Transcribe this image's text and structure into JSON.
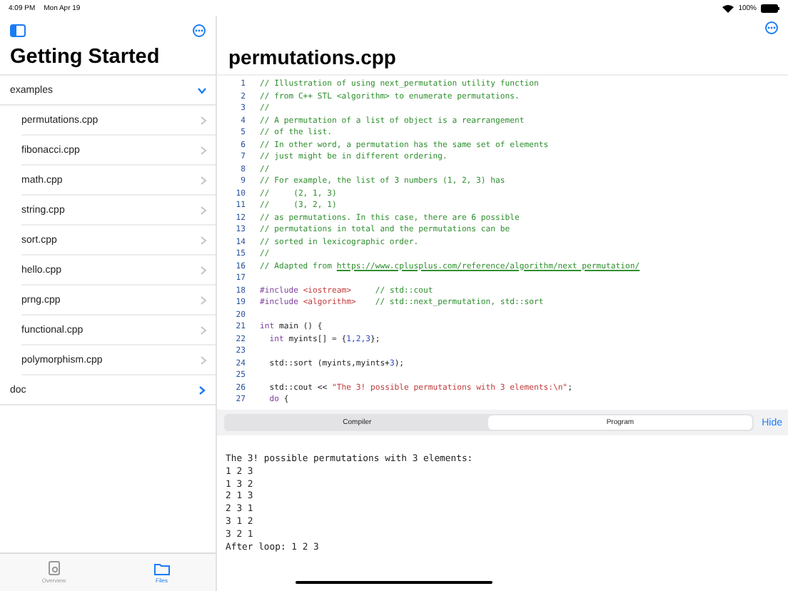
{
  "status_bar": {
    "time": "4:09 PM",
    "date": "Mon Apr 19",
    "battery": "100%"
  },
  "sidebar": {
    "title": "Getting Started",
    "tree": [
      {
        "label": "examples",
        "expanded": true,
        "children": [
          {
            "label": "permutations.cpp"
          },
          {
            "label": "fibonacci.cpp"
          },
          {
            "label": "math.cpp"
          },
          {
            "label": "string.cpp"
          },
          {
            "label": "sort.cpp"
          },
          {
            "label": "hello.cpp"
          },
          {
            "label": "prng.cpp"
          },
          {
            "label": "functional.cpp"
          },
          {
            "label": "polymorphism.cpp"
          }
        ]
      },
      {
        "label": "doc",
        "expanded": false
      }
    ]
  },
  "tab_bar": [
    {
      "label": "Overview",
      "selected": false
    },
    {
      "label": "Files",
      "selected": true
    }
  ],
  "editor": {
    "title": "permutations.cpp",
    "lines": [
      {
        "number": "1",
        "tokens": [
          {
            "kind": "comment",
            "text": "// Illustration of using next_permutation utility function"
          }
        ]
      },
      {
        "number": "2",
        "tokens": [
          {
            "kind": "comment",
            "text": "// from C++ STL <algorithm> to enumerate permutations."
          }
        ]
      },
      {
        "number": "3",
        "tokens": [
          {
            "kind": "comment",
            "text": "//"
          }
        ]
      },
      {
        "number": "4",
        "tokens": [
          {
            "kind": "comment",
            "text": "// A permutation of a list of object is a rearrangement"
          }
        ]
      },
      {
        "number": "5",
        "tokens": [
          {
            "kind": "comment",
            "text": "// of the list."
          }
        ]
      },
      {
        "number": "6",
        "tokens": [
          {
            "kind": "comment",
            "text": "// In other word, a permutation has the same set of elements"
          }
        ]
      },
      {
        "number": "7",
        "tokens": [
          {
            "kind": "comment",
            "text": "// just might be in different ordering."
          }
        ]
      },
      {
        "number": "8",
        "tokens": [
          {
            "kind": "comment",
            "text": "//"
          }
        ]
      },
      {
        "number": "9",
        "tokens": [
          {
            "kind": "comment",
            "text": "// For example, the list of 3 numbers (1, 2, 3) has"
          }
        ]
      },
      {
        "number": "10",
        "tokens": [
          {
            "kind": "comment",
            "text": "//     (2, 1, 3)"
          }
        ]
      },
      {
        "number": "11",
        "tokens": [
          {
            "kind": "comment",
            "text": "//     (3, 2, 1)"
          }
        ]
      },
      {
        "number": "12",
        "tokens": [
          {
            "kind": "comment",
            "text": "// as permutations. In this case, there are 6 possible"
          }
        ]
      },
      {
        "number": "13",
        "tokens": [
          {
            "kind": "comment",
            "text": "// permutations in total and the permutations can be"
          }
        ]
      },
      {
        "number": "14",
        "tokens": [
          {
            "kind": "comment",
            "text": "// sorted in lexicographic order."
          }
        ]
      },
      {
        "number": "15",
        "tokens": [
          {
            "kind": "comment",
            "text": "//"
          }
        ]
      },
      {
        "number": "16",
        "tokens": [
          {
            "kind": "comment",
            "text": "// Adapted from "
          },
          {
            "kind": "link",
            "text": "https://www.cplusplus.com/reference/algorithm/next_permutation/"
          }
        ]
      },
      {
        "number": "17"
      },
      {
        "number": "18",
        "tokens": [
          {
            "kind": "keyword",
            "text": "#include "
          },
          {
            "kind": "string",
            "text": "<iostream>"
          },
          {
            "kind": "comment",
            "text": "     // std::cout"
          }
        ]
      },
      {
        "number": "19",
        "tokens": [
          {
            "kind": "keyword",
            "text": "#include "
          },
          {
            "kind": "string",
            "text": "<algorithm>"
          },
          {
            "kind": "comment",
            "text": "    // std::next_permutation, std::sort"
          }
        ]
      },
      {
        "number": "20"
      },
      {
        "number": "21",
        "tokens": [
          {
            "kind": "keyword",
            "text": "int"
          },
          {
            "kind": "plain",
            "text": " main () {"
          }
        ]
      },
      {
        "number": "22",
        "tokens": [
          {
            "kind": "keyword",
            "text": "  int"
          },
          {
            "kind": "plain",
            "text": " myints[] = {"
          },
          {
            "kind": "number",
            "text": "1,2,3"
          },
          {
            "kind": "plain",
            "text": "};"
          }
        ]
      },
      {
        "number": "23"
      },
      {
        "number": "24",
        "tokens": [
          {
            "kind": "plain",
            "text": "  std::sort (myints,myints+"
          },
          {
            "kind": "number",
            "text": "3"
          },
          {
            "kind": "plain",
            "text": ");"
          }
        ]
      },
      {
        "number": "25"
      },
      {
        "number": "26",
        "tokens": [
          {
            "kind": "plain",
            "text": "  std::cout << "
          },
          {
            "kind": "string",
            "text": "\"The 3! possible permutations with 3 elements:\\n\""
          },
          {
            "kind": "plain",
            "text": ";"
          }
        ]
      },
      {
        "number": "27",
        "tokens": [
          {
            "kind": "keyword",
            "text": "  do"
          },
          {
            "kind": "plain",
            "text": " {"
          }
        ]
      }
    ]
  },
  "output_tabs": [
    {
      "label": "Compiler",
      "selected": false
    },
    {
      "label": "Program",
      "selected": true
    }
  ],
  "hide_button": "Hide",
  "output": [
    "The 3! possible permutations with 3 elements:",
    "1 2 3",
    "1 3 2",
    "2 1 3",
    "2 3 1",
    "3 1 2",
    "3 2 1",
    "After loop: 1 2 3"
  ]
}
